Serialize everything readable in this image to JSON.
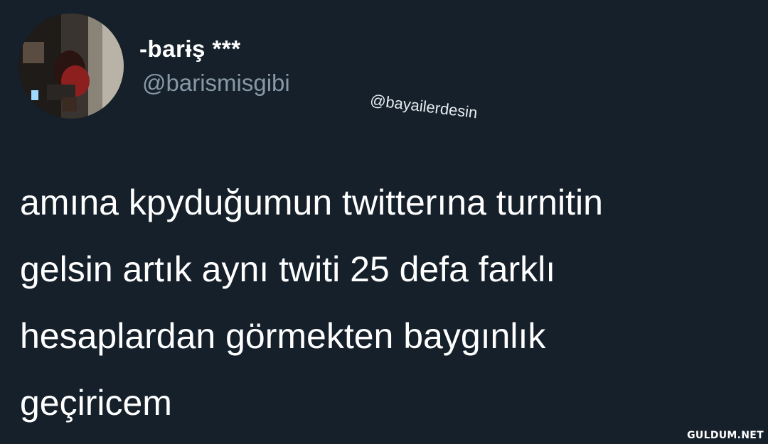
{
  "tweet": {
    "author": {
      "display_name": "-barɨş ***",
      "handle": "@barismisgibi",
      "avatar_icon": "profile-photo"
    },
    "text_lines": [
      "amına kpyduğumun twitterına turnitin",
      "gelsin artık aynı twiti 25 defa farklı",
      "hesaplardan görmekten baygınlık",
      "geçiricem"
    ]
  },
  "overlay": {
    "watermark": "@bayailerdesin",
    "site_mark": "GULDUM.NET"
  },
  "colors": {
    "background": "#15202b",
    "primary_text": "#ffffff",
    "secondary_text": "#8899a6"
  }
}
